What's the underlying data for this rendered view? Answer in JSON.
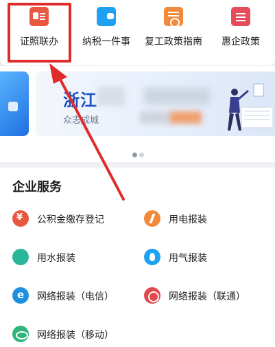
{
  "quick_access": [
    {
      "label": "证照联办",
      "icon": "certificate-icon"
    },
    {
      "label": "纳税一件事",
      "icon": "wallet-icon"
    },
    {
      "label": "复工政策指南",
      "icon": "policy-guide-icon"
    },
    {
      "label": "惠企政策",
      "icon": "enterprise-policy-icon"
    }
  ],
  "banner": {
    "title_visible": "浙江",
    "subtitle_visible": "众志成城"
  },
  "services": {
    "title": "企业服务",
    "items": [
      {
        "label": "公积金缴存登记",
        "icon": "housing-fund-icon"
      },
      {
        "label": "用电报装",
        "icon": "electricity-icon"
      },
      {
        "label": "用水报装",
        "icon": "water-drop-icon"
      },
      {
        "label": "用气报装",
        "icon": "gas-flame-icon"
      },
      {
        "label": "网络报装（电信）",
        "icon": "china-telecom-icon"
      },
      {
        "label": "网络报装（联通）",
        "icon": "china-unicom-icon"
      },
      {
        "label": "网络报装（移动）",
        "icon": "china-mobile-icon"
      }
    ]
  },
  "colors": {
    "highlight": "#e02b2b",
    "banner_title": "#1c4fc2"
  }
}
